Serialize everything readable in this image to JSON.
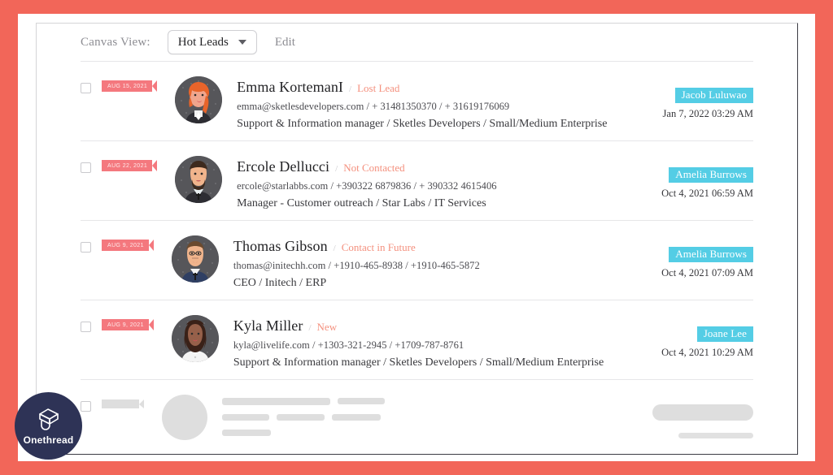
{
  "theme": {
    "frame_color": "#F26659",
    "ribbon_color": "#F4787E",
    "owner_badge_color": "#54CDE5",
    "status_color": "#F4907E",
    "logo_color": "#2E3356"
  },
  "toolbar": {
    "label": "Canvas View:",
    "selected_view": "Hot Leads",
    "edit_label": "Edit"
  },
  "rows": [
    {
      "date_badge": "AUG 15, 2021",
      "name": "Emma KortemanI",
      "separator": "/",
      "status": "Lost Lead",
      "contact": "emma@sketlesdevelopers.com / + 31481350370 / + 31619176069",
      "role": "Support & Information manager / Sketles Developers / Small/Medium Enterprise",
      "owner": "Jacob Luluwao",
      "timestamp": "Jan 7, 2022 03:29 AM",
      "avatar": "avatar-emma"
    },
    {
      "date_badge": "AUG 22, 2021",
      "name": "Ercole Dellucci",
      "separator": "/",
      "status": "Not Contacted",
      "contact": "ercole@starlabbs.com / +390322 6879836 / + 390332 4615406",
      "role": "Manager - Customer outreach / Star Labs / IT Services",
      "owner": "Amelia Burrows",
      "timestamp": "Oct 4, 2021 06:59 AM",
      "avatar": "avatar-ercole"
    },
    {
      "date_badge": "AUG 9, 2021",
      "name": "Thomas Gibson",
      "separator": "/",
      "status": "Contact in Future",
      "contact": "thomas@initechh.com / +1910-465-8938 / +1910-465-5872",
      "role": "CEO / Initech / ERP",
      "owner": "Amelia Burrows",
      "timestamp": "Oct 4, 2021 07:09 AM",
      "avatar": "avatar-thomas"
    },
    {
      "date_badge": "AUG 9, 2021",
      "name": "Kyla Miller",
      "separator": "/",
      "status": "New",
      "contact": "kyla@livelife.com / +1303-321-2945 / +1709-787-8761",
      "role": "Support & Information manager / Sketles Developers / Small/Medium Enterprise",
      "owner": "Joane Lee",
      "timestamp": "Oct 4, 2021 10:29 AM",
      "avatar": "avatar-kyla"
    }
  ],
  "logo": {
    "word": "Onethread"
  }
}
